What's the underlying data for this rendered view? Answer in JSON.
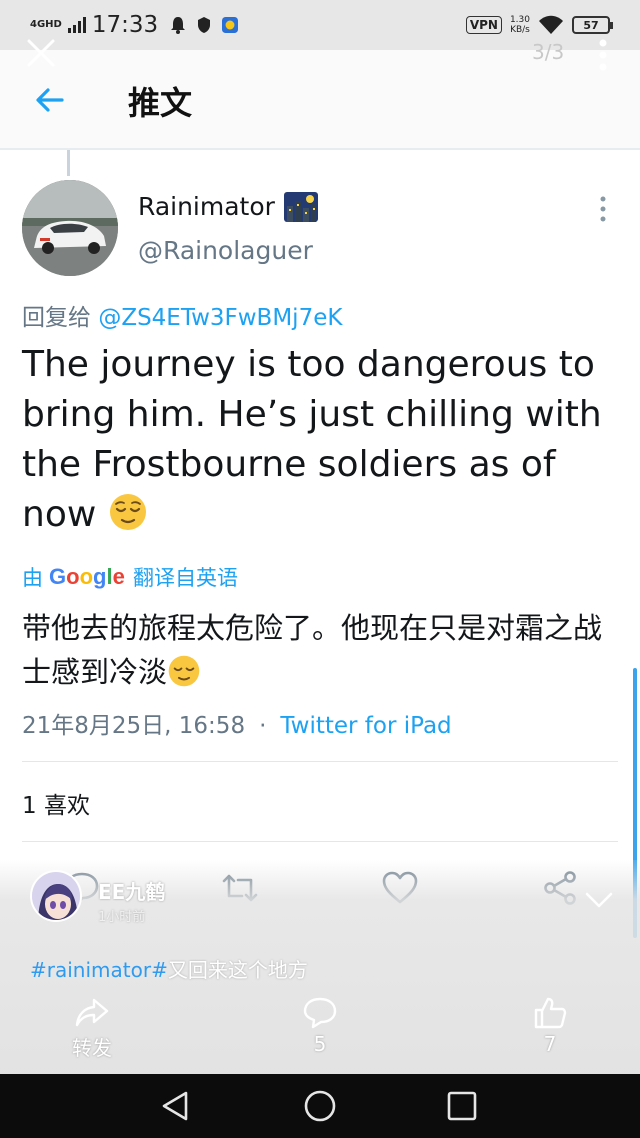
{
  "status_bar": {
    "network": "4GHD",
    "time": "17:33",
    "vpn": "VPN",
    "speed_value": "1.30",
    "speed_unit": "KB/s",
    "battery": "57"
  },
  "gallery": {
    "page_counter": "3/3",
    "poster_name": "EE九鹤",
    "poster_sub": "1小时前",
    "caption_tag": "#rainimator#",
    "caption_text": "又回来这个地方",
    "repost_label": "转发",
    "comment_count": "5",
    "like_count": "7"
  },
  "header": {
    "title": "推文"
  },
  "tweet": {
    "display_name": "Rainimator",
    "handle": "@Rainolaguer",
    "reply_prefix": "回复给 ",
    "reply_to": "@ZS4ETw3FwBMj7eK",
    "text": "The journey is too dangerous to bring him. He’s just chilling with the Frostbourne soldiers as of now",
    "translated_prefix": "由",
    "translated_suffix": "翻译自英语",
    "translation": "带他去的旅程太危险了。他现在只是对霜之战士感到冷淡",
    "date": "21年8月25日, 16:58",
    "separator": "·",
    "source": "Twitter for iPad",
    "likes": "1 喜欢"
  },
  "colors": {
    "twitter_blue": "#1da1f2",
    "text_secondary": "#657786",
    "scrollbar": "#3aa3ec"
  },
  "icons": {
    "back": "arrow-left-icon",
    "reply": "comment-icon",
    "retweet": "retweet-icon",
    "like": "heart-icon",
    "share": "share-icon"
  }
}
